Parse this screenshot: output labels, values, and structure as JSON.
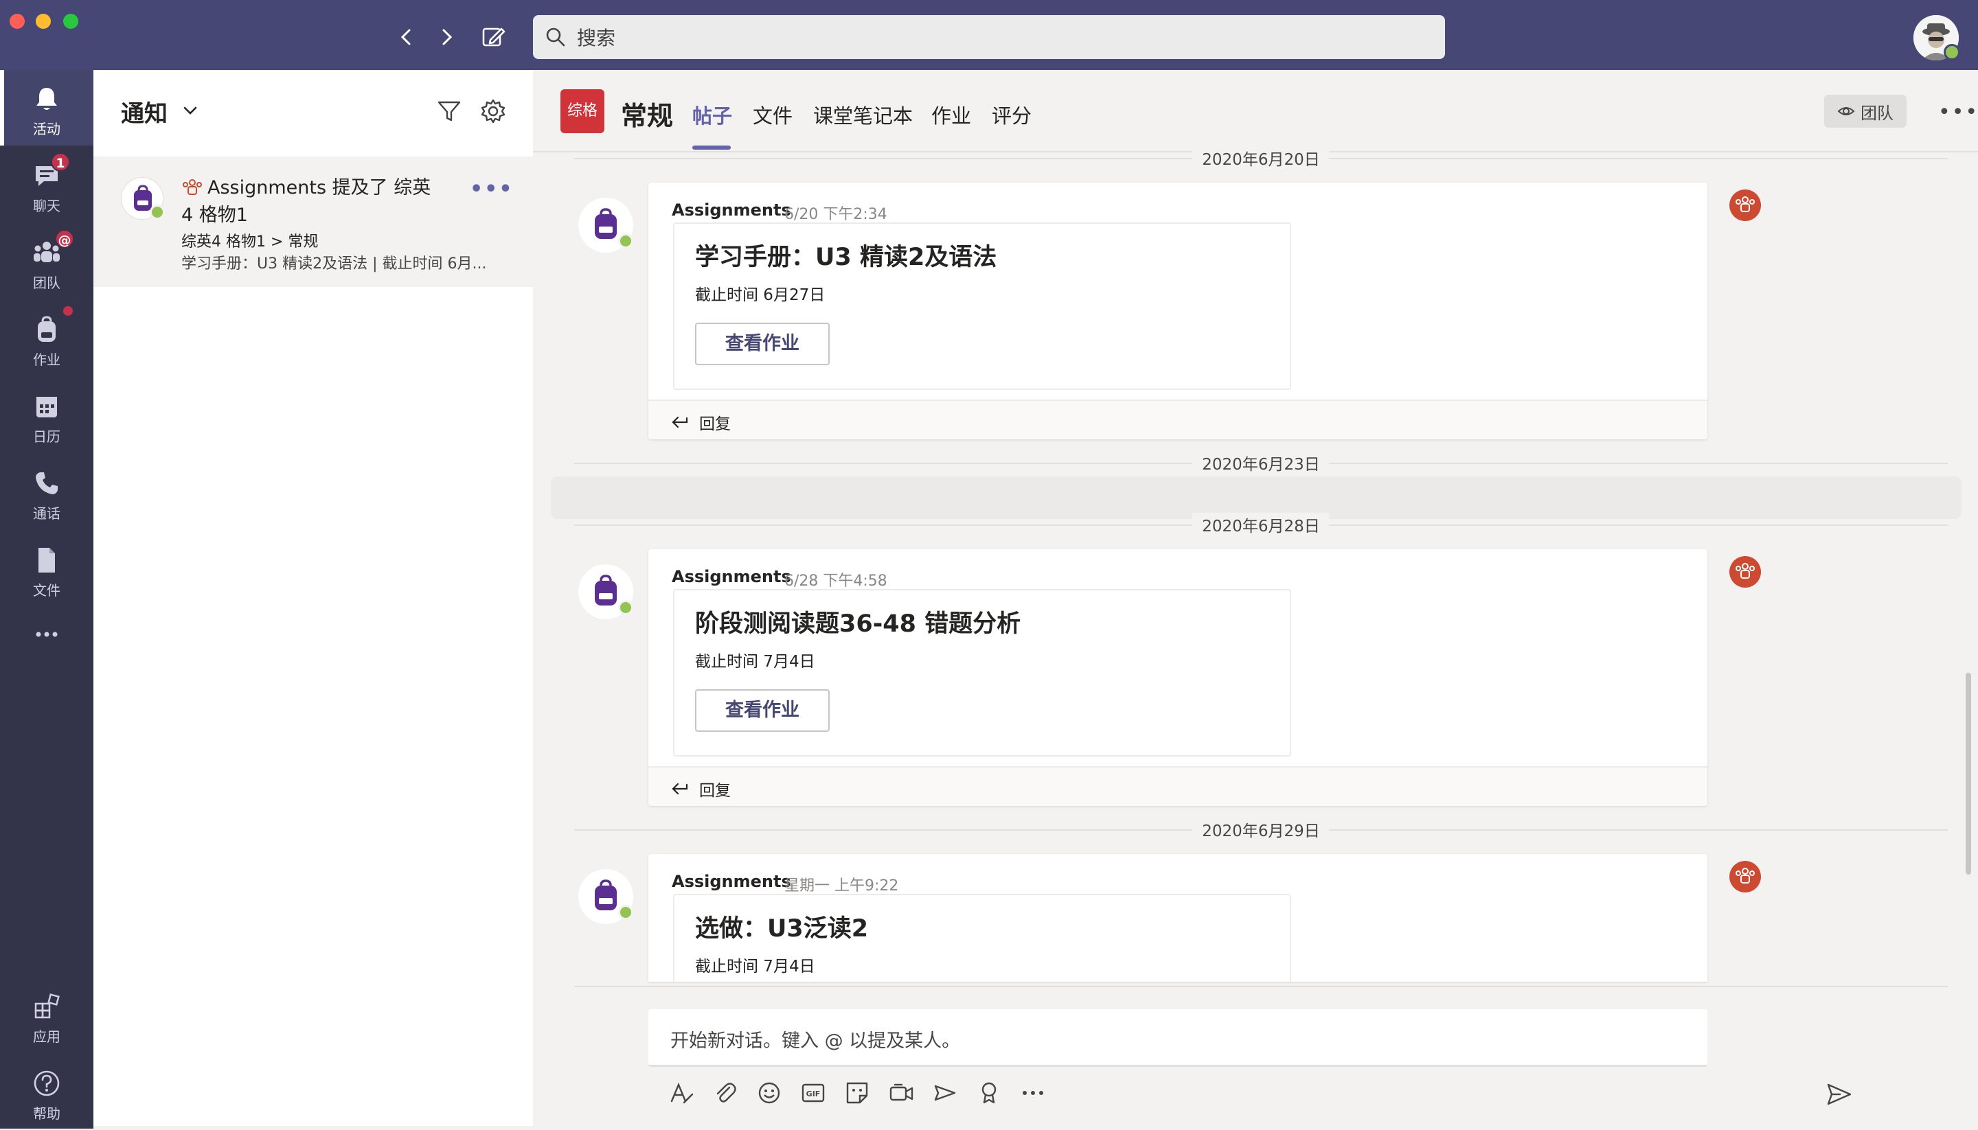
{
  "search": {
    "placeholder": "搜索"
  },
  "colors": {
    "titlebar": "#464775",
    "rail": "#33344a",
    "accent": "#6264a7",
    "team_tile": "#d13438",
    "badge": "#c4314b",
    "online": "#92c353"
  },
  "rail": [
    {
      "label": "活动",
      "icon": "bell-icon"
    },
    {
      "label": "聊天",
      "icon": "chat-icon",
      "badge": "1"
    },
    {
      "label": "团队",
      "icon": "teams-icon",
      "badge": "@"
    },
    {
      "label": "作业",
      "icon": "backpack-icon"
    },
    {
      "label": "日历",
      "icon": "calendar-icon"
    },
    {
      "label": "通话",
      "icon": "phone-icon"
    },
    {
      "label": "文件",
      "icon": "file-icon"
    },
    {
      "label": "应用",
      "icon": "apps-icon"
    },
    {
      "label": "帮助",
      "icon": "help-icon"
    }
  ],
  "activity": {
    "title": "通知",
    "item": {
      "line1": "Assignments 提及了 综英4 格物1",
      "line2": "综英4 格物1 > 常规",
      "line3": "学习手册：U3 精读2及语法 | 截止时间 6月..."
    }
  },
  "channel": {
    "team_tile": "综格",
    "name": "常规",
    "tabs": [
      "帖子",
      "文件",
      "课堂笔记本",
      "作业",
      "评分"
    ],
    "team_button": "团队"
  },
  "dates": [
    "2020年6月20日",
    "2020年6月23日",
    "2020年6月28日",
    "2020年6月29日"
  ],
  "posts": [
    {
      "author": "Assignments",
      "time": "6/20 下午2:34",
      "title": "学习手册：U3 精读2及语法",
      "due": "截止时间 6月27日",
      "button": "查看作业",
      "reply": "回复"
    },
    {
      "author": "Assignments",
      "time": "6/28 下午4:58",
      "title": "阶段测阅读题36-48 错题分析",
      "due": "截止时间 7月4日",
      "button": "查看作业",
      "reply": "回复"
    },
    {
      "author": "Assignments",
      "time": "星期一 上午9:22",
      "title": "选做：U3泛读2",
      "due": "截止时间 7月4日"
    }
  ],
  "compose": {
    "placeholder": "开始新对话。键入 @ 以提及某人。"
  }
}
